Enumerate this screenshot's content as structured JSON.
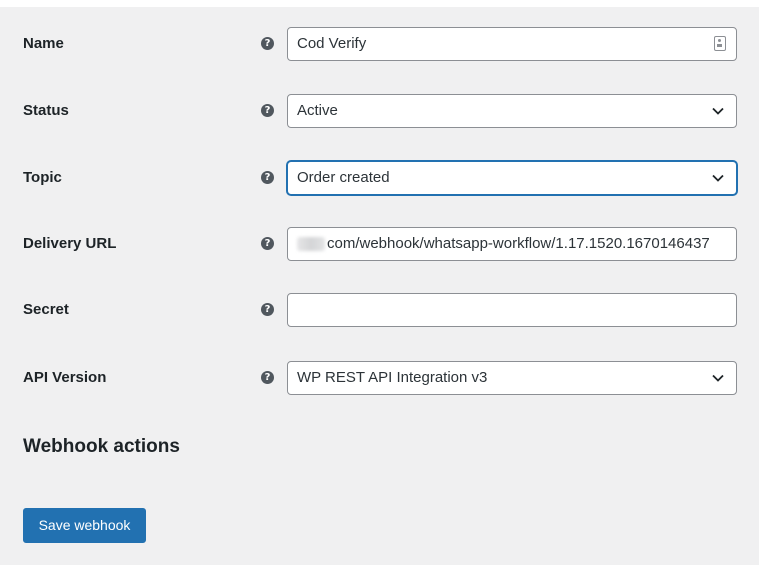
{
  "form": {
    "name": {
      "label": "Name",
      "value": "Cod Verify"
    },
    "status": {
      "label": "Status",
      "selected": "Active"
    },
    "topic": {
      "label": "Topic",
      "selected": "Order created"
    },
    "delivery_url": {
      "label": "Delivery URL",
      "value": "com/webhook/whatsapp-workflow/1.17.1520.1670146437"
    },
    "secret": {
      "label": "Secret",
      "value": ""
    },
    "api_version": {
      "label": "API Version",
      "selected": "WP REST API Integration v3"
    }
  },
  "help_icon_glyph": "?",
  "webhook_actions": {
    "heading": "Webhook actions"
  },
  "save_button": {
    "label": "Save webhook"
  },
  "icons": {
    "help": "question-circle-icon",
    "dropdown": "chevron-down-icon",
    "autofill": "contact-card-icon"
  },
  "colors": {
    "accent": "#2271b1",
    "background": "#f0f0f1",
    "border": "#8c8f94",
    "text": "#1d2327"
  }
}
